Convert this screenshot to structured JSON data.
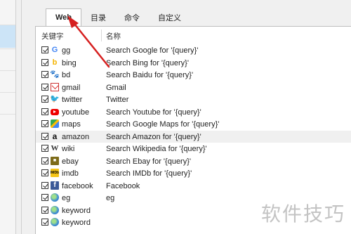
{
  "tabs": [
    {
      "label": "Web",
      "active": true
    },
    {
      "label": "目录"
    },
    {
      "label": "命令"
    },
    {
      "label": "自定义"
    }
  ],
  "table": {
    "col_keyword": "关键字",
    "col_name": "名称",
    "rows": [
      {
        "keyword": "gg",
        "name": "Search Google for '{query}'",
        "icon": "google-icon",
        "glyph": "G"
      },
      {
        "keyword": "bing",
        "name": "Search Bing for '{query}'",
        "icon": "bing-icon",
        "glyph": "b"
      },
      {
        "keyword": "bd",
        "name": "Search Baidu for '{query}'",
        "icon": "baidu-icon",
        "glyph": "🐾"
      },
      {
        "keyword": "gmail",
        "name": "Gmail",
        "icon": "gmail-icon",
        "glyph": ""
      },
      {
        "keyword": "twitter",
        "name": "Twitter",
        "icon": "twitter-icon",
        "glyph": "🐦"
      },
      {
        "keyword": "youtube",
        "name": "Search Youtube for '{query}'",
        "icon": "youtube-icon",
        "glyph": ""
      },
      {
        "keyword": "maps",
        "name": "Search Google Maps for '{query}'",
        "icon": "maps-icon",
        "glyph": ""
      },
      {
        "keyword": "amazon",
        "name": "Search Amazon for '{query}'",
        "icon": "amazon-icon",
        "glyph": "a"
      },
      {
        "keyword": "wiki",
        "name": "Search Wikipedia for '{query}'",
        "icon": "wikipedia-icon",
        "glyph": "W"
      },
      {
        "keyword": "ebay",
        "name": "Search Ebay for '{query}'",
        "icon": "ebay-icon",
        "glyph": "■"
      },
      {
        "keyword": "imdb",
        "name": "Search IMDb for '{query}'",
        "icon": "imdb-icon",
        "glyph": "IMDb"
      },
      {
        "keyword": "facebook",
        "name": "Facebook",
        "icon": "facebook-icon",
        "glyph": "f"
      },
      {
        "keyword": "eg",
        "name": "eg",
        "icon": "globe-icon",
        "glyph": ""
      },
      {
        "keyword": "keyword",
        "name": "",
        "icon": "globe-icon",
        "glyph": ""
      },
      {
        "keyword": "keyword",
        "name": "",
        "icon": "globe-icon",
        "glyph": ""
      }
    ]
  },
  "highlight_row": 7,
  "watermark": "软件技巧",
  "colors": {
    "accent": "#cce4f7",
    "arrow": "#d62020"
  }
}
